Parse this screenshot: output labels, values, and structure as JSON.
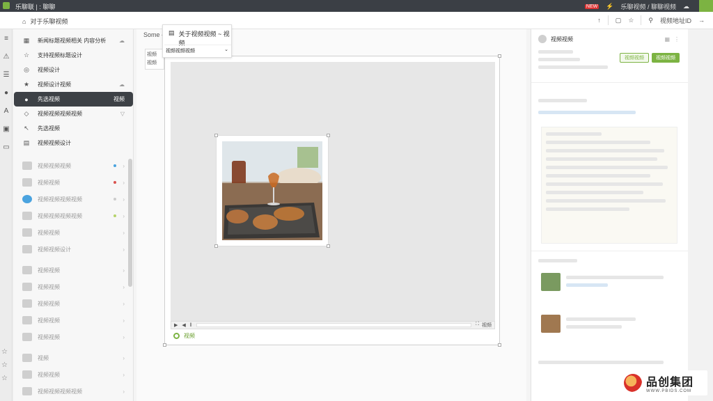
{
  "topbar": {
    "title": "乐聊联 | : 聊聊",
    "right_text": "乐聊视频 / 聊聊视频",
    "badge": "NEW"
  },
  "toolbar": {
    "breadcrumb_icon": "home-icon",
    "breadcrumb": "对于乐聊视频",
    "right_label": "视频地址ID"
  },
  "rail": {
    "icons": [
      "menu-icon",
      "warning-icon",
      "list-icon",
      "user-icon",
      "text-icon",
      "image-icon",
      "folder-icon"
    ]
  },
  "sidebar": {
    "items": [
      {
        "label": "新闻标题视频相关 内容分析",
        "icon": "grid-icon"
      },
      {
        "label": "支持视频标题设计",
        "icon": "star-icon"
      },
      {
        "label": "视频设计",
        "icon": "camera-icon"
      },
      {
        "label": "视频设计视频",
        "icon": "star-fill-icon"
      },
      {
        "label": "先选视频",
        "icon": "drop-icon",
        "active": true,
        "right": "视频"
      },
      {
        "label": "视频视频视频视频",
        "icon": "shield-icon"
      },
      {
        "label": "先选视频",
        "icon": "cursor-icon"
      },
      {
        "label": "视频视频设计",
        "icon": "lock-icon"
      }
    ],
    "groups": [
      {
        "label": "视频视频视频"
      },
      {
        "label": "视频视频"
      },
      {
        "label": "视频视频视频视频"
      },
      {
        "label": "视频视频视频视频"
      },
      {
        "label": "视频视频"
      },
      {
        "label": "视频视频设计"
      },
      {
        "label": "视频视频"
      },
      {
        "label": "视频视频"
      },
      {
        "label": "视频视频"
      },
      {
        "label": "视频视频"
      },
      {
        "label": "视频视频"
      },
      {
        "label": "视频"
      },
      {
        "label": "视频视频"
      },
      {
        "label": "视频视频视频视频"
      }
    ]
  },
  "main": {
    "label": "Some -",
    "smallbox_line1": "视频",
    "smallbox_line2": "视频"
  },
  "dropdown": {
    "title": "关于视频视频 ~ 视频",
    "selected": "视频视频视频"
  },
  "canvas": {
    "status": "视频",
    "ctrl_right": "视频"
  },
  "rightpanel": {
    "header": "视频视频",
    "btn_outline": "视频视频",
    "btn_fill": "视频视频"
  },
  "brand": {
    "name": "品创集团",
    "url": "WWW.PBIDS.COM"
  }
}
